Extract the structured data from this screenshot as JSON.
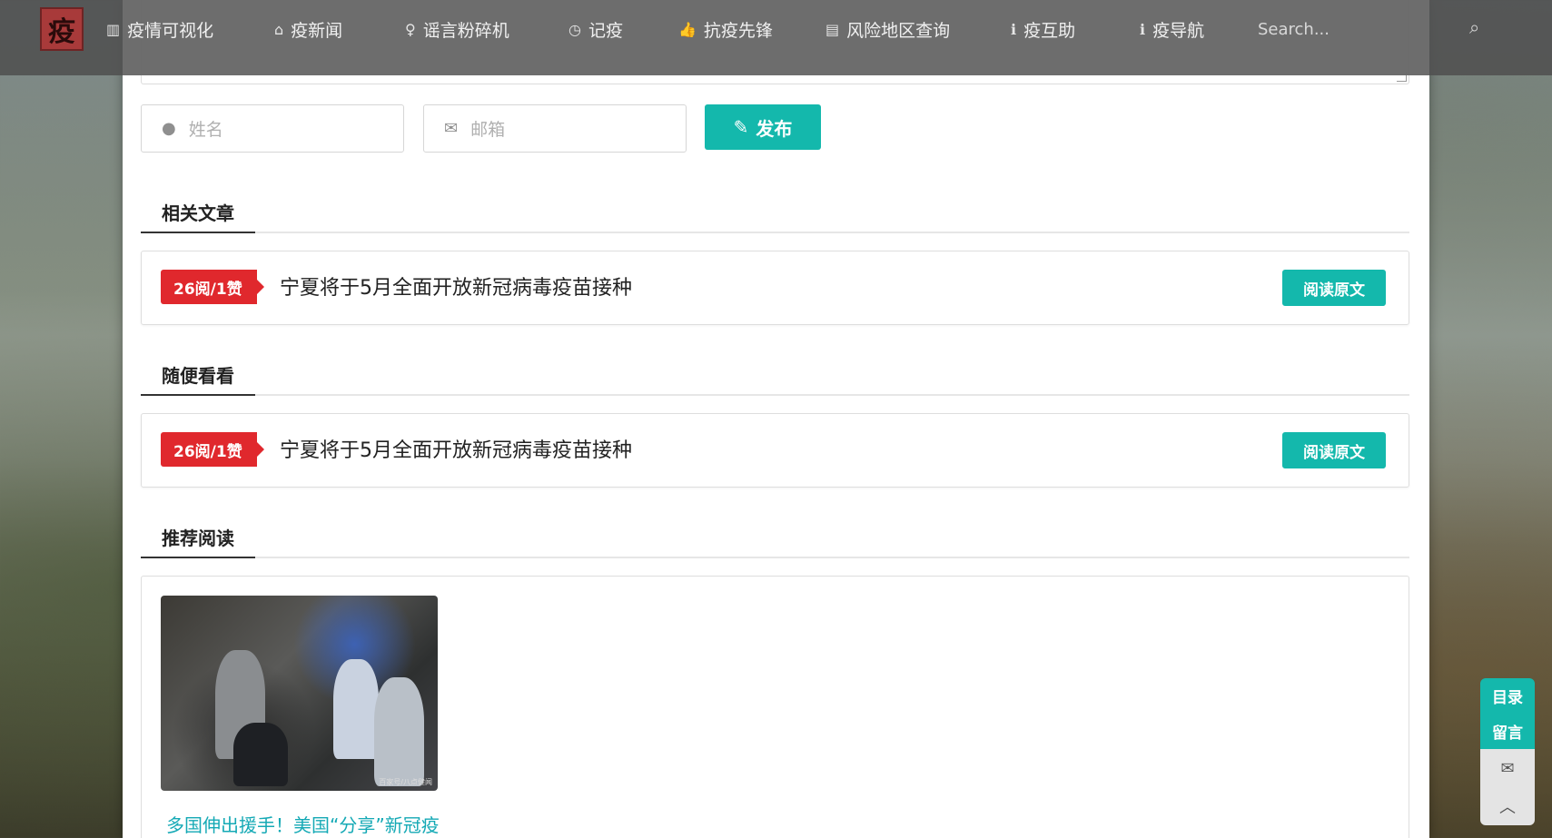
{
  "nav": {
    "logo_char": "疫",
    "items": [
      {
        "icon": "bar-chart-icon",
        "glyph": "▥",
        "label": "疫情可视化"
      },
      {
        "icon": "home-icon",
        "glyph": "⌂",
        "label": "疫新闻"
      },
      {
        "icon": "lightbulb-icon",
        "glyph": "♀",
        "label": "谣言粉碎机"
      },
      {
        "icon": "clock-icon",
        "glyph": "◷",
        "label": "记疫"
      },
      {
        "icon": "thumbs-up-icon",
        "glyph": "👍",
        "label": "抗疫先锋"
      },
      {
        "icon": "book-icon",
        "glyph": "▤",
        "label": "风险地区查询"
      },
      {
        "icon": "info-icon",
        "glyph": "ℹ",
        "label": "疫互助"
      },
      {
        "icon": "info-icon",
        "glyph": "ℹ",
        "label": "疫导航"
      }
    ],
    "search_placeholder": "Search...",
    "search_glyph": "⌕"
  },
  "comment_form": {
    "name_placeholder": "姓名",
    "email_placeholder": "邮箱",
    "publish_label": "发布"
  },
  "sections": {
    "related": "相关文章",
    "random": "随便看看",
    "recommended": "推荐阅读"
  },
  "related_article": {
    "tag": "26阅/1赞",
    "title": "宁夏将于5月全面开放新冠病毒疫苗接种",
    "read_label": "阅读原文"
  },
  "random_article": {
    "tag": "26阅/1赞",
    "title": "宁夏将于5月全面开放新冠病毒疫苗接种",
    "read_label": "阅读原文"
  },
  "recommended_item": {
    "title": "多国伸出援手！美国“分享”新冠疫",
    "watermark": "百家号/八点健闻"
  },
  "side_tools": {
    "toc_label": "目录",
    "comment_label": "留言",
    "wechat_glyph": "✉",
    "top_glyph": "︿"
  },
  "colors": {
    "accent": "#14b8ac",
    "tag_red": "#e0282d",
    "link": "#14a9b5"
  }
}
